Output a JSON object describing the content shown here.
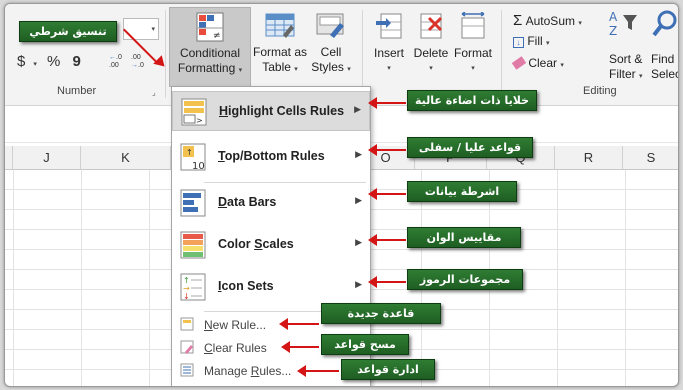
{
  "callout_top": "تنسيق شرطي",
  "ribbon": {
    "number": {
      "symbols": [
        "$",
        "%",
        "9"
      ],
      "dec_inc": ".00 +.0",
      "dec_dec": ".00 →.0",
      "group_label": "Number"
    },
    "conditional_formatting": {
      "line1": "Conditional",
      "line2": "Formatting"
    },
    "format_as_table": {
      "line1": "Format as",
      "line2": "Table"
    },
    "cell_styles": {
      "line1": "Cell",
      "line2": "Styles"
    },
    "insert": "Insert",
    "delete": "Delete",
    "format": "Format",
    "editing": {
      "autosum": "AutoSum",
      "fill": "Fill",
      "clear": "Clear",
      "sort_filter": {
        "line1": "Sort &",
        "line2": "Filter"
      },
      "find_select": {
        "line1": "Find &",
        "line2": "Select"
      },
      "group_label": "Editing"
    }
  },
  "columns": [
    "J",
    "K",
    "O",
    "P",
    "Q",
    "R",
    "S"
  ],
  "menu": {
    "items": [
      {
        "label": "Highlight Cells Rules",
        "callout": "خلايا ذات اضاءة عالية"
      },
      {
        "label": "Top/Bottom Rules",
        "callout": "قواعد عليا / سفلى"
      },
      {
        "label": "Data Bars",
        "callout": "اشرطة بيانات"
      },
      {
        "label": "Color Scales",
        "callout": "مقاييس الوان"
      },
      {
        "label": "Icon Sets",
        "callout": "مجموعات الرموز"
      }
    ],
    "small_items": [
      {
        "label": "New Rule...",
        "callout": "قاعدة جديدة"
      },
      {
        "label": "Clear Rules",
        "callout": "مسح قواعد"
      },
      {
        "label": "Manage Rules...",
        "callout": "ادارة قواعد"
      }
    ]
  },
  "colors": {
    "callout_green": "#2f7d33",
    "arrow_red": "#d31515",
    "ribbon_bg": "#f3f3f3"
  }
}
